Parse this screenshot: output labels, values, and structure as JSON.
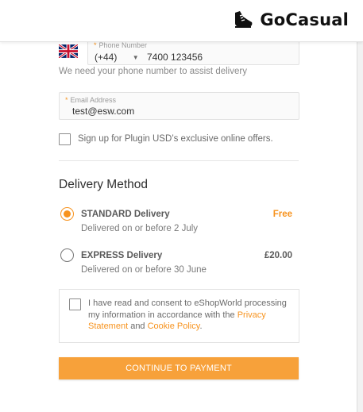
{
  "brand": {
    "name": "GoCasual",
    "icon": "sneaker-icon"
  },
  "phone": {
    "label": "Phone Number",
    "required_mark": "*",
    "country_code": "(+44)",
    "number": "7400 123456",
    "flag": "uk-flag-icon",
    "helper": "We need your phone number to assist delivery"
  },
  "email": {
    "label": "Email Address",
    "required_mark": "*",
    "value": "test@esw.com"
  },
  "signup": {
    "label": "Sign up for Plugin USD’s exclusive online offers.",
    "checked": false
  },
  "delivery": {
    "title": "Delivery Method",
    "options": [
      {
        "name": "STANDARD Delivery",
        "eta": "Delivered on or before 2 July",
        "price": "Free",
        "selected": true,
        "price_color": "#f7931e"
      },
      {
        "name": "EXPRESS Delivery",
        "eta": "Delivered on or before 30 June",
        "price": "£20.00",
        "selected": false,
        "price_color": "#5a5a5a"
      }
    ]
  },
  "consent": {
    "text_before": "I have read and consent to eShopWorld processing my information in accordance with the ",
    "privacy_link": "Privacy Statement",
    "and_text": " and ",
    "cookie_link": "Cookie Policy",
    "end": ".",
    "checked": false
  },
  "cta": {
    "label": "CONTINUE TO PAYMENT"
  },
  "colors": {
    "accent": "#f7931e",
    "button": "#f7a13a"
  }
}
